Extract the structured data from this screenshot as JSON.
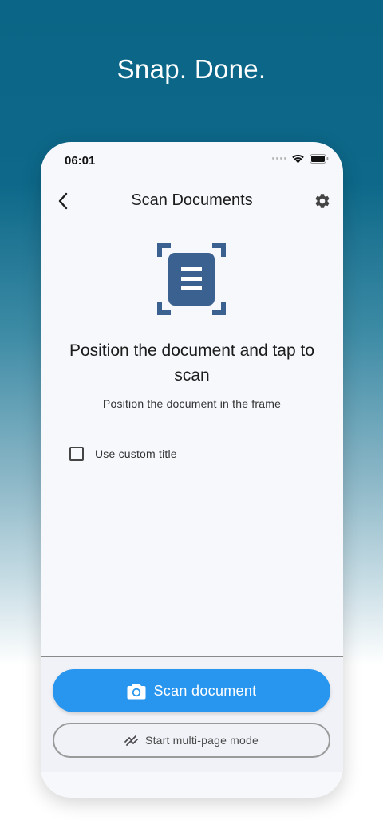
{
  "promo": {
    "headline": "Snap. Done."
  },
  "status_bar": {
    "time": "06:01"
  },
  "app_bar": {
    "title": "Scan Documents"
  },
  "content": {
    "title": "Position the document and tap to scan",
    "subtitle": "Position the document in the frame",
    "custom_title_checkbox": {
      "label": "Use custom title",
      "checked": false
    }
  },
  "actions": {
    "scan_button_label": "Scan document",
    "multipage_button_label": "Start multi-page mode"
  },
  "icons": {
    "back": "chevron-left-icon",
    "settings": "gear-icon",
    "illustration": "document-scan-icon",
    "camera": "camera-icon",
    "multipage": "multi-page-icon",
    "wifi": "wifi-icon",
    "battery": "battery-icon"
  },
  "colors": {
    "primary": "#2896ef",
    "illustration": "#3a6190",
    "background_top": "#0b6586"
  }
}
